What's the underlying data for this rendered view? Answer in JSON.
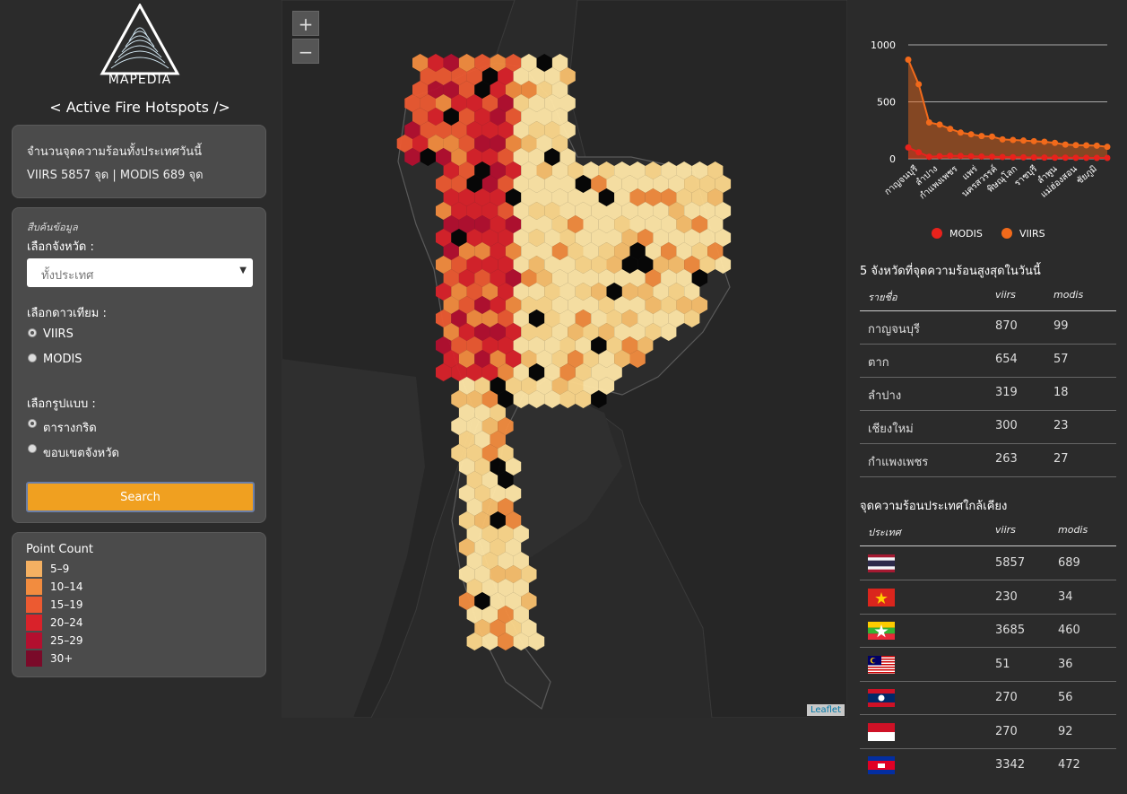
{
  "app": {
    "brand": "MAPEDIA",
    "title": "< Active Fire Hotspots />"
  },
  "summary": {
    "line1": "จำนวนจุดความร้อนทั้งประเทศวันนี้",
    "line2": "VIIRS 5857 จุด | MODIS 689 จุด"
  },
  "search": {
    "caption": "สืบค้นข้อมูล",
    "province_label": "เลือกจังหวัด :",
    "province_value": "ทั้งประเทศ",
    "satellite_label": "เลือกดาวเทียม :",
    "satellite_options": [
      "VIIRS",
      "MODIS"
    ],
    "style_label": "เลือกรูปแบบ :",
    "style_options": [
      "ตารางกริด",
      "ขอบเขตจังหวัด"
    ],
    "button": "Search"
  },
  "legend": {
    "title": "Point Count",
    "items": [
      {
        "label": "5–9",
        "color": "#f4b062"
      },
      {
        "label": "10–14",
        "color": "#f28c3f"
      },
      {
        "label": "15–19",
        "color": "#ec5a31"
      },
      {
        "label": "20–24",
        "color": "#d9222a"
      },
      {
        "label": "25–29",
        "color": "#b30f2f"
      },
      {
        "label": "30+",
        "color": "#7a0a29"
      }
    ]
  },
  "map": {
    "zoom_in": "+",
    "zoom_out": "−",
    "attribution": "Leaflet"
  },
  "chart_data": {
    "type": "area",
    "categories": [
      "กาญจนบุรี",
      "ลำปาง",
      "กำแพงเพชร",
      "แพร่",
      "นครสวรรค์",
      "พิษณุโลก",
      "ราชบุรี",
      "ลำพูน",
      "แม่ฮ่องสอน",
      "ชัยภูมิ"
    ],
    "series": [
      {
        "name": "MODIS",
        "color": "#e8221c",
        "values": [
          99,
          57,
          18,
          23,
          27,
          25,
          22,
          20,
          18,
          16,
          14,
          13,
          12,
          11,
          10,
          10,
          9,
          9,
          8,
          8
        ]
      },
      {
        "name": "VIIRS",
        "color": "#f26a1b",
        "values": [
          870,
          654,
          319,
          300,
          263,
          230,
          215,
          200,
          195,
          170,
          165,
          160,
          155,
          150,
          140,
          125,
          120,
          118,
          115,
          105
        ]
      }
    ],
    "yticks": [
      0,
      500,
      1000
    ],
    "ylim": [
      0,
      1000
    ]
  },
  "top5": {
    "title": "5 จังหวัดที่จุดความร้อนสูงสุดในวันนี้",
    "headers": [
      "รายชื่อ",
      "viirs",
      "modis"
    ],
    "rows": [
      [
        "กาญจนบุรี",
        "870",
        "99"
      ],
      [
        "ตาก",
        "654",
        "57"
      ],
      [
        "ลำปาง",
        "319",
        "18"
      ],
      [
        "เชียงใหม่",
        "300",
        "23"
      ],
      [
        "กำแพงเพชร",
        "263",
        "27"
      ]
    ]
  },
  "neighbors": {
    "title": "จุดความร้อนประเทศใกล้เคียง",
    "headers": [
      "ประเทศ",
      "viirs",
      "modis"
    ],
    "rows": [
      {
        "flag": "thailand-flag",
        "viirs": "5857",
        "modis": "689"
      },
      {
        "flag": "vietnam-flag",
        "viirs": "230",
        "modis": "34"
      },
      {
        "flag": "myanmar-flag",
        "viirs": "3685",
        "modis": "460"
      },
      {
        "flag": "malaysia-flag",
        "viirs": "51",
        "modis": "36"
      },
      {
        "flag": "laos-flag",
        "viirs": "270",
        "modis": "56"
      },
      {
        "flag": "indonesia-flag",
        "viirs": "270",
        "modis": "92"
      },
      {
        "flag": "cambodia-flag",
        "viirs": "3342",
        "modis": "472"
      }
    ]
  }
}
